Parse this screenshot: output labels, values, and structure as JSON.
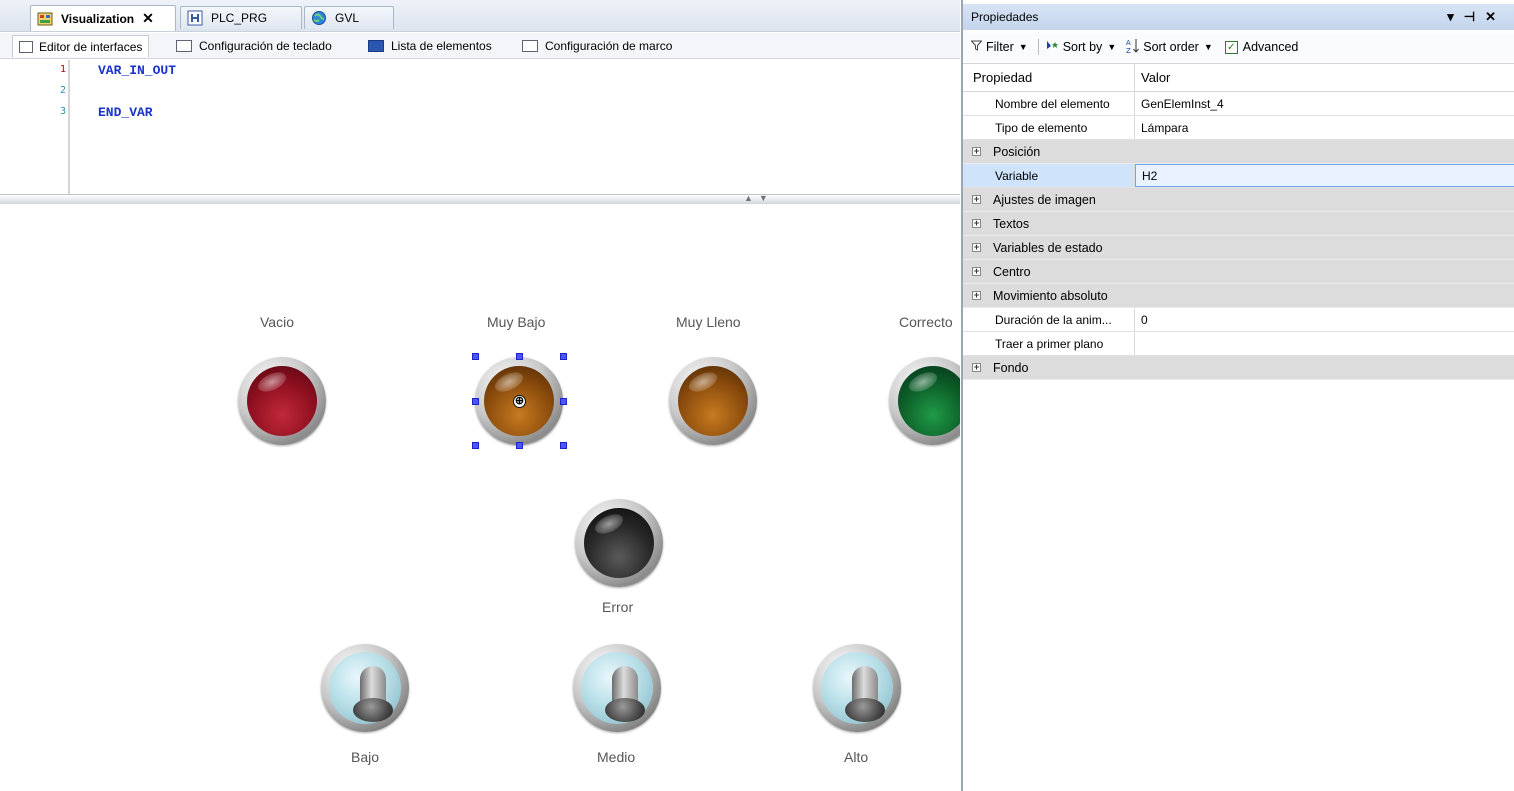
{
  "tabs": [
    {
      "label": "Visualization",
      "close": "✕"
    },
    {
      "label": "PLC_PRG"
    },
    {
      "label": "GVL"
    }
  ],
  "subtabs": [
    {
      "label": "Editor de interfaces"
    },
    {
      "label": "Configuración de teclado"
    },
    {
      "label": "Lista de elementos"
    },
    {
      "label": "Configuración de marco"
    }
  ],
  "code": {
    "line_numbers": [
      "1",
      "2",
      "3"
    ],
    "lines": [
      "VAR_IN_OUT",
      "",
      "END_VAR"
    ]
  },
  "canvas": {
    "lamps": [
      {
        "label": "Vacio",
        "color": "#8d0f1f"
      },
      {
        "label": "Muy Bajo",
        "color": "#8a4b0c",
        "selected": true
      },
      {
        "label": "Muy Lleno",
        "color": "#8a4b0c"
      },
      {
        "label": "Correcto",
        "color": "#0c5c27"
      },
      {
        "label": "Error",
        "color": "#262626"
      }
    ],
    "switches": [
      {
        "label": "Bajo"
      },
      {
        "label": "Medio"
      },
      {
        "label": "Alto"
      }
    ],
    "selection_center_icon": "⊕"
  },
  "panel": {
    "title": "Propiedades",
    "title_icons": [
      "pin-dropdown-icon",
      "pin-icon",
      "close-icon"
    ],
    "toolbar": {
      "filter": "Filter",
      "sort_by": "Sort by",
      "sort_order": "Sort order",
      "advanced": "Advanced",
      "advanced_checked": true
    },
    "columns": {
      "property": "Propiedad",
      "value": "Valor"
    },
    "rows": [
      {
        "name": "Nombre del elemento",
        "value": "GenElemInst_4",
        "group": false
      },
      {
        "name": "Tipo de elemento",
        "value": "Lámpara",
        "group": false
      },
      {
        "name": "Posición",
        "value": "",
        "group": true
      },
      {
        "name": "Variable",
        "value": "H2",
        "group": false,
        "selected": true
      },
      {
        "name": "Ajustes de imagen",
        "value": "",
        "group": true
      },
      {
        "name": "Textos",
        "value": "",
        "group": true
      },
      {
        "name": "Variables de estado",
        "value": "",
        "group": true
      },
      {
        "name": "Centro",
        "value": "",
        "group": true
      },
      {
        "name": "Movimiento absoluto",
        "value": "",
        "group": true
      },
      {
        "name": "Duración de la anim...",
        "value": "0",
        "group": false
      },
      {
        "name": "Traer a primer plano",
        "value": "",
        "group": false
      },
      {
        "name": "Fondo",
        "value": "",
        "group": true
      }
    ]
  },
  "colors": {
    "accent": "#4a55ff",
    "selection_row": "#cfe3fb",
    "code_keyword": "#1a34c9"
  }
}
